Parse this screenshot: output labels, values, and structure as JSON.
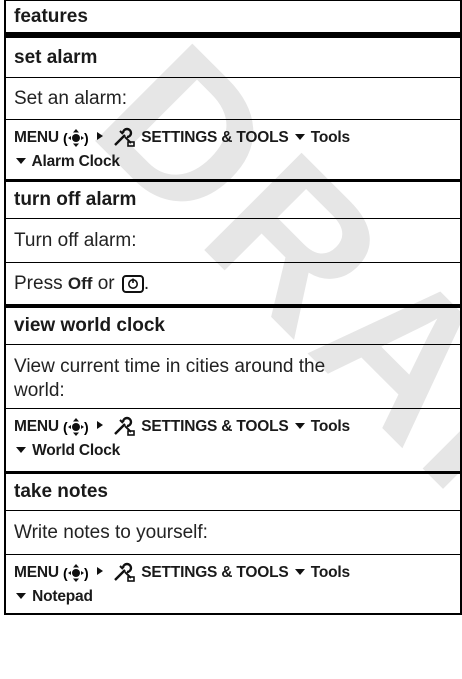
{
  "watermark": "DRAFT",
  "header": {
    "title": "features"
  },
  "sections": [
    {
      "title": "set alarm",
      "desc": "Set an alarm:",
      "path": {
        "menu": "MENU",
        "settings": "SETTINGS & TOOLS",
        "item1": "Tools",
        "item2": "Alarm Clock"
      }
    },
    {
      "title": "turn off alarm",
      "desc": "Turn off alarm:",
      "press": {
        "prefix": "Press",
        "key": "Off",
        "or": "or",
        "suffix": "."
      }
    },
    {
      "title": "view world clock",
      "desc": "View current time in cities around the world:",
      "path": {
        "menu": "MENU",
        "settings": "SETTINGS & TOOLS",
        "item1": "Tools",
        "item2": "World Clock"
      }
    },
    {
      "title": "take notes",
      "desc": "Write notes to yourself:",
      "path": {
        "menu": "MENU",
        "settings": "SETTINGS & TOOLS",
        "item1": "Tools",
        "item2": "Notepad"
      }
    }
  ],
  "icons": {
    "nav_key": "nav-key-icon",
    "settings_tools": "settings-tools-icon",
    "right_arrow": "right-arrow-icon",
    "down_arrow": "down-arrow-icon",
    "end_key": "end-key-icon"
  }
}
